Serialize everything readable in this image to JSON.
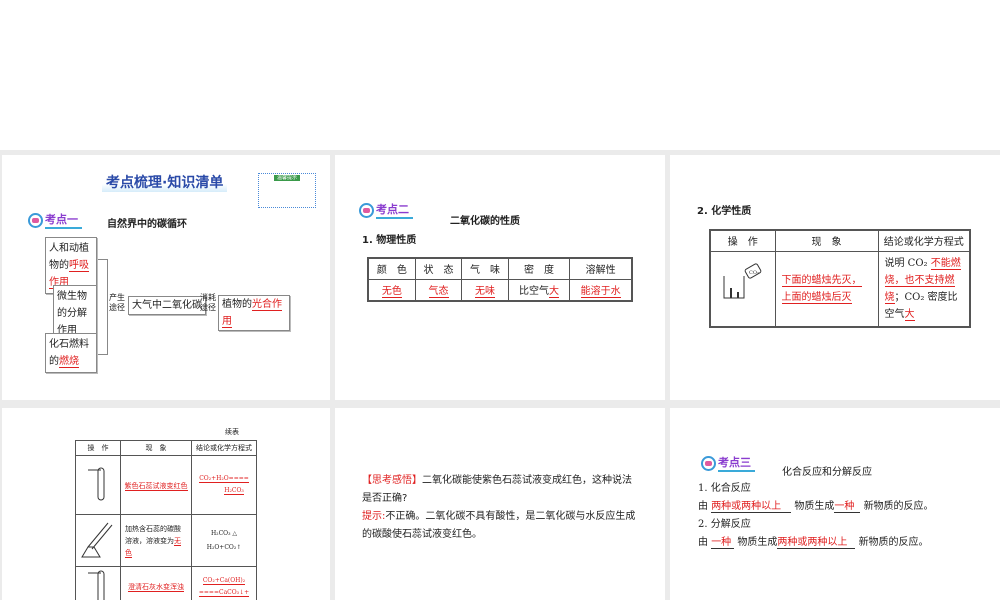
{
  "slides": [
    {
      "title": "考点梳理·知识清单",
      "note": "温馨提示",
      "badge": "考点一",
      "topic": "自然界中的碳循环",
      "sources": [
        {
          "text": "人和动植物的",
          "answer": "呼吸作用"
        },
        {
          "text": "微生物的分解作用",
          "answer": ""
        },
        {
          "text": "化石燃料的",
          "answer": "燃烧"
        }
      ],
      "produce": "产生途径",
      "center": "大气中二氧化碳",
      "consume": "消耗途径",
      "sink_text": "植物的",
      "sink_answer": "光合作用"
    },
    {
      "badge": "考点二",
      "topic": "二氧化碳的性质",
      "subtitle": "1. 物理性质",
      "headers": [
        "颜　色",
        "状　态",
        "气　味",
        "密　度",
        "溶解性"
      ],
      "values": [
        "无色",
        "气态",
        "无味",
        "大",
        "能溶于水"
      ],
      "density_prefix": "比空气"
    },
    {
      "subtitle": "2. 化学性质",
      "headers": [
        "操　作",
        "现　象",
        "结论或化学方程式"
      ],
      "co2_label": "CO₂",
      "phenomenon": [
        "下面的蜡烛先灭，",
        "上面的蜡烛后灭"
      ],
      "conclusion_prefix": "说明 CO₂ ",
      "conclusion_answer": "不能燃烧，也不支持燃烧",
      "conclusion_mid": "；CO₂ 密度比空气",
      "conclusion_answer2": "大"
    },
    {
      "caption": "续表",
      "headers": [
        "操　作",
        "现　象",
        "结论或化学方程式"
      ],
      "rows": [
        {
          "phen": "紫色石蕊试液变红色",
          "eq": [
            "CO₂+H₂O====",
            "H₂CO₃"
          ]
        },
        {
          "phen_text": "加热含石蕊的碳酸溶液，溶液变为",
          "phen_answer": "无色",
          "eq": [
            "H₂CO₃ △",
            "H₂O+CO₂↑"
          ]
        },
        {
          "phen": "澄清石灰水变浑浊",
          "eq": [
            "CO₂+Ca(OH)₂",
            "====CaCO₃↓+"
          ]
        }
      ]
    },
    {
      "label": "【思考感悟】",
      "question": "二氧化碳能使紫色石蕊试液变成红色，这种说法是否正确?",
      "hint_label": "提示:",
      "hint": "不正确。二氧化碳不具有酸性，是二氧化碳与水反应生成的碳酸使石蕊试液变红色。"
    },
    {
      "badge": "考点三",
      "topic": "化合反应和分解反应",
      "s1": "1. 化合反应",
      "s1_a": "由",
      "s1_b": "两种或两种以上",
      "s1_c": "物质生成",
      "s1_d": "一种",
      "s1_e": "新物质的反应。",
      "s2": "2. 分解反应",
      "s2_a": "由",
      "s2_b": "一种",
      "s2_c": "物质生成",
      "s2_d": "两种或两种以上",
      "s2_e": "新物质的反应。"
    }
  ]
}
